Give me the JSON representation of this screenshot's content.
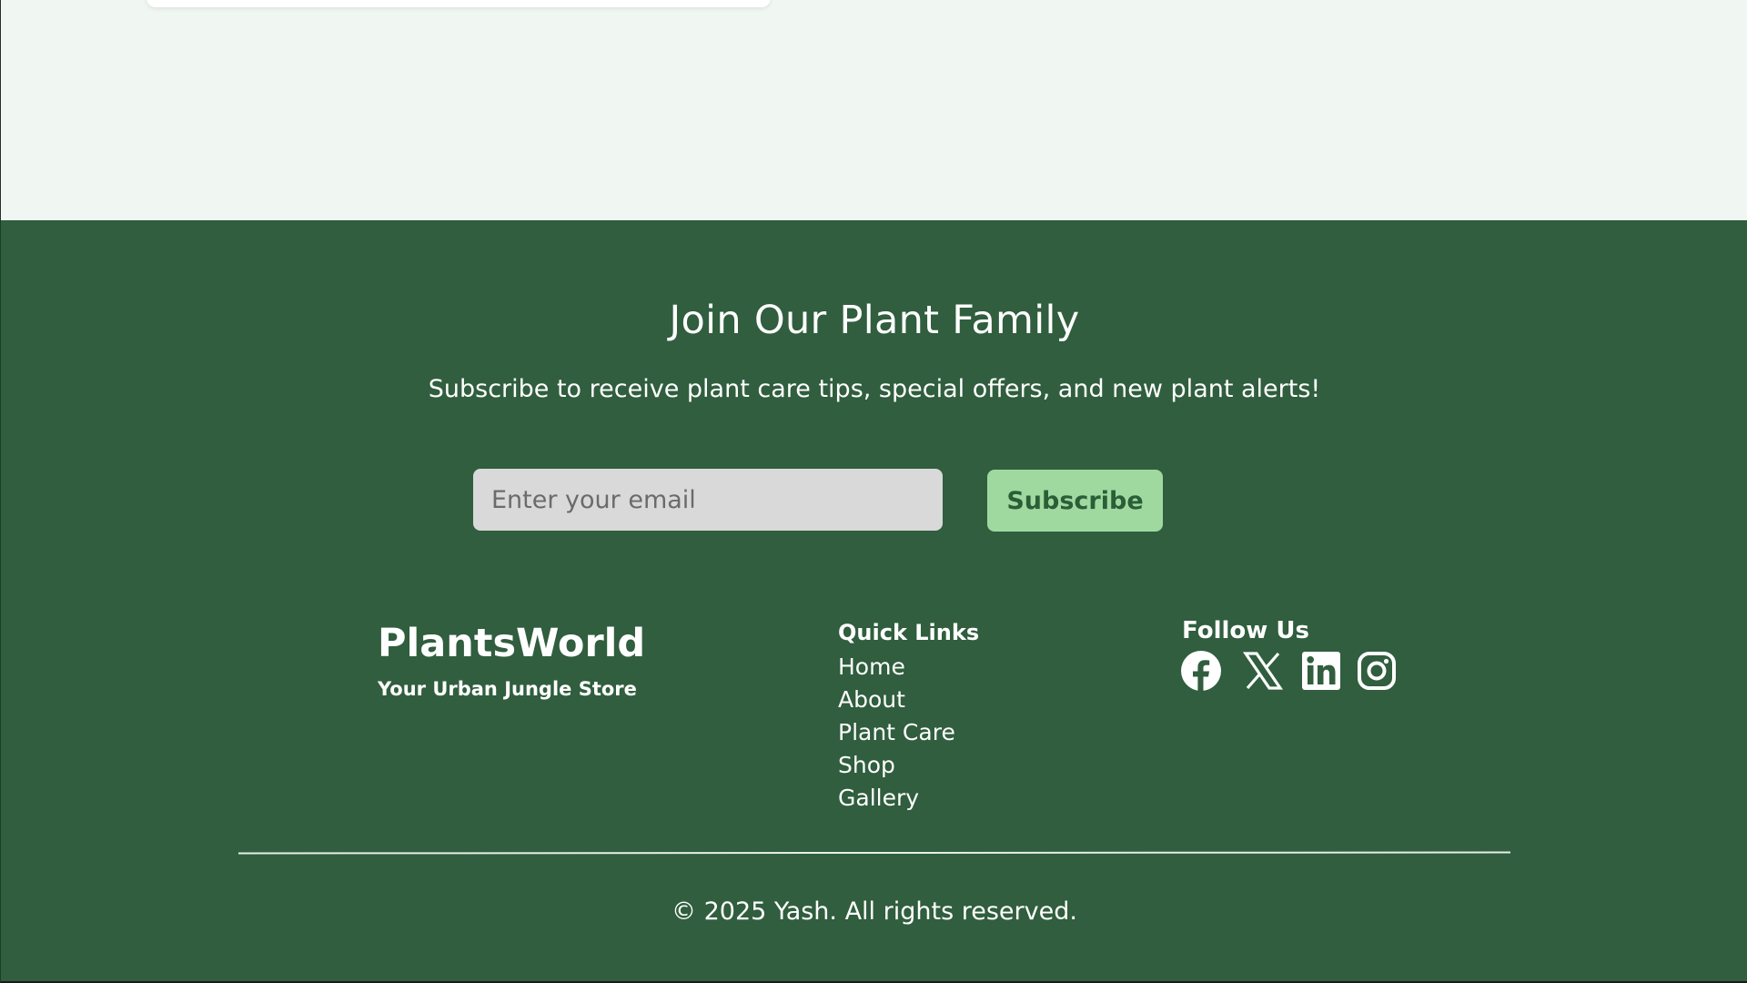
{
  "colors": {
    "page_background": "#f0f6f1",
    "footer_background": "#305e3e",
    "subscribe_button": "#9fd9a0",
    "input_background": "#d9d9d9"
  },
  "newsletter": {
    "title": "Join Our Plant Family",
    "subtitle": "Subscribe to receive plant care tips, special offers, and new plant alerts!",
    "email_placeholder": "Enter your email",
    "subscribe_label": "Subscribe"
  },
  "brand": {
    "name": "PlantsWorld",
    "tagline": "Your Urban Jungle Store"
  },
  "quick_links": {
    "heading": "Quick Links",
    "items": [
      "Home",
      "About",
      "Plant Care",
      "Shop",
      "Gallery"
    ]
  },
  "social": {
    "heading": "Follow Us",
    "icons": [
      "facebook-icon",
      "x-icon",
      "linkedin-icon",
      "instagram-icon"
    ]
  },
  "copyright": "© 2025 Yash. All rights reserved."
}
